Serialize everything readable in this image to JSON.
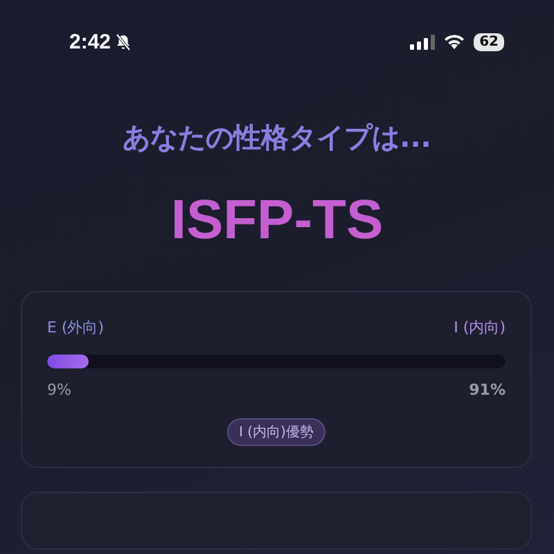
{
  "status_bar": {
    "time": "2:42",
    "battery": "62"
  },
  "heading": "あなたの性格タイプは...",
  "type_code": "ISFP-TS",
  "dimension": {
    "left_label": "E (外向)",
    "right_label": "I (内向)",
    "level": 0.09,
    "left_percent": "9%",
    "right_percent": "91%",
    "badge": "I (内向)優勢"
  }
}
